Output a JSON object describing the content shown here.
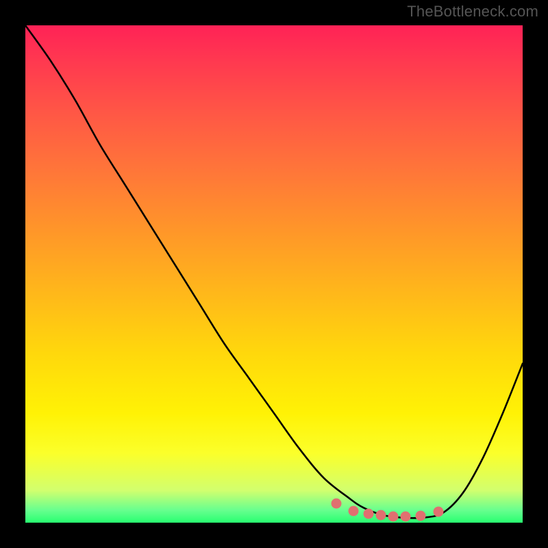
{
  "watermark": "TheBottleneck.com",
  "chart_data": {
    "type": "line",
    "title": "",
    "xlabel": "",
    "ylabel": "",
    "xlim": [
      0,
      100
    ],
    "ylim": [
      0,
      100
    ],
    "background_gradient": {
      "orientation": "vertical",
      "stops": [
        {
          "pos": 0,
          "color": "#ff2256"
        },
        {
          "pos": 50,
          "color": "#ffb81a"
        },
        {
          "pos": 85,
          "color": "#fbff2a"
        },
        {
          "pos": 100,
          "color": "#28ff70"
        }
      ]
    },
    "series": [
      {
        "name": "bottleneck-curve",
        "color": "#000000",
        "x": [
          0,
          5,
          10,
          15,
          20,
          25,
          30,
          35,
          40,
          45,
          50,
          55,
          60,
          65,
          68,
          72,
          76,
          80,
          84,
          88,
          92,
          96,
          100
        ],
        "y": [
          100,
          93,
          85,
          76,
          68,
          60,
          52,
          44,
          36,
          29,
          22,
          15,
          9,
          5,
          3,
          1.5,
          1,
          1,
          2,
          6,
          13,
          22,
          32
        ]
      }
    ],
    "highlight_points": {
      "name": "optimal-range-markers",
      "color": "#e07070",
      "x": [
        62.5,
        66,
        69,
        71.5,
        74,
        76.5,
        79.5,
        83
      ],
      "y": [
        3.8,
        2.4,
        1.8,
        1.5,
        1.3,
        1.2,
        1.4,
        2.2
      ]
    }
  }
}
